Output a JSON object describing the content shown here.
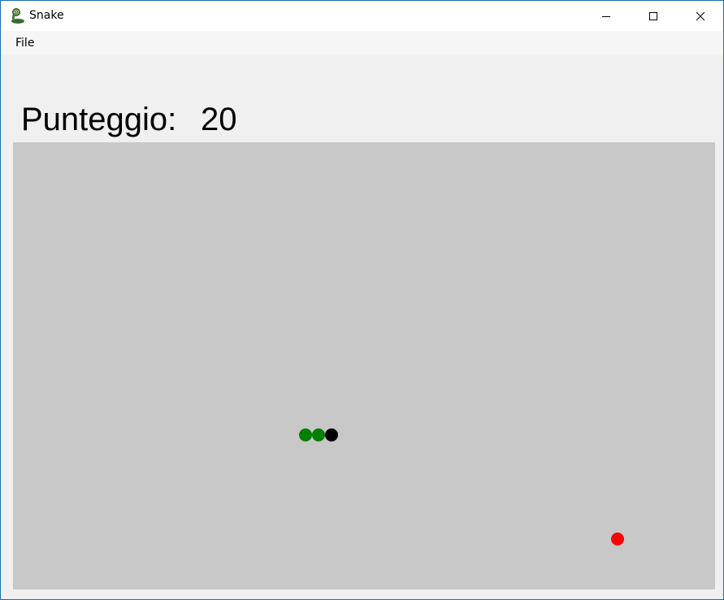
{
  "window": {
    "title": "Snake",
    "app_icon": "snake-app-icon",
    "controls": [
      "minimize-icon",
      "maximize-icon",
      "close-icon"
    ]
  },
  "menu": {
    "items": [
      {
        "label": "File"
      }
    ]
  },
  "score": {
    "label": "Punteggio:",
    "value": "20"
  },
  "board": {
    "background": "#c8c8c8",
    "snake": {
      "body_color": "#007f00",
      "head_color": "#000000",
      "segments": 3
    },
    "food": {
      "color": "#ff0000"
    }
  }
}
